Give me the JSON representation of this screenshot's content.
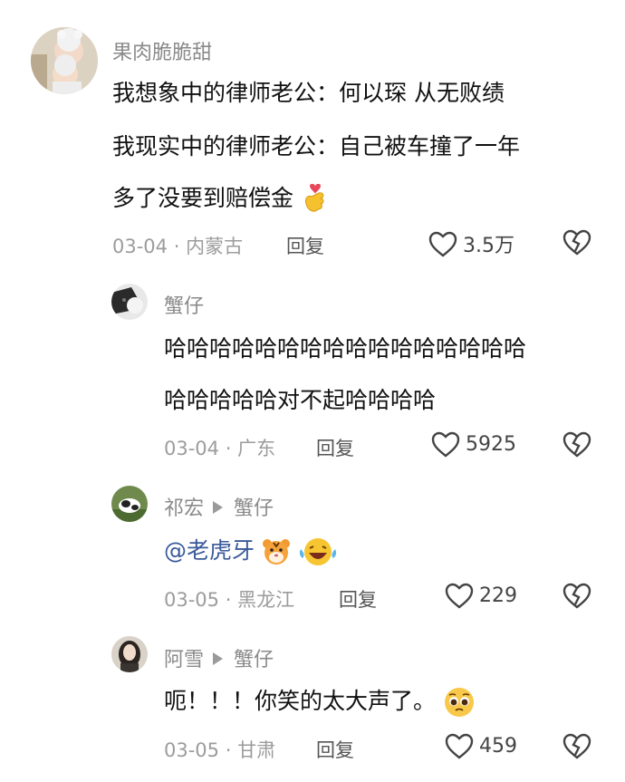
{
  "comments": [
    {
      "user": "果肉脆脆甜",
      "lines": [
        "我想象中的律师老公：何以琛 从无败绩",
        "我现实中的律师老公：自己被车撞了一年",
        "多了没要到赔偿金"
      ],
      "date": "03-04",
      "location": "内蒙古",
      "reply_label": "回复",
      "likes": "3.5万",
      "avatar_icon": "baby-photo-avatar",
      "emoji": "finger-heart-emoji"
    },
    {
      "user": "蟹仔",
      "lines": [
        "哈哈哈哈哈哈哈哈哈哈哈哈哈哈哈哈",
        "哈哈哈哈哈对不起哈哈哈哈"
      ],
      "date": "03-04",
      "location": "广东",
      "reply_label": "回复",
      "likes": "5925",
      "avatar_icon": "cat-photo-avatar"
    },
    {
      "user": "祁宏",
      "reply_to": "蟹仔",
      "mention": "@老虎牙",
      "date": "03-05",
      "location": "黑龙江",
      "reply_label": "回复",
      "likes": "229",
      "avatar_icon": "cow-photo-avatar",
      "emojis": [
        "tiger-emoji",
        "laughing-tears-emoji"
      ]
    },
    {
      "user": "阿雪",
      "reply_to": "蟹仔",
      "text": "呃！！！你笑的太大声了。",
      "date": "03-05",
      "location": "甘肃",
      "reply_label": "回复",
      "likes": "459",
      "avatar_icon": "girl-photo-avatar",
      "emoji": "pleading-face-emoji"
    }
  ],
  "meta_separator": "·",
  "colors": {
    "mention": "#3a5a9a",
    "meta": "#9c9c9c",
    "name": "#8a8a8a",
    "text": "#111111"
  }
}
